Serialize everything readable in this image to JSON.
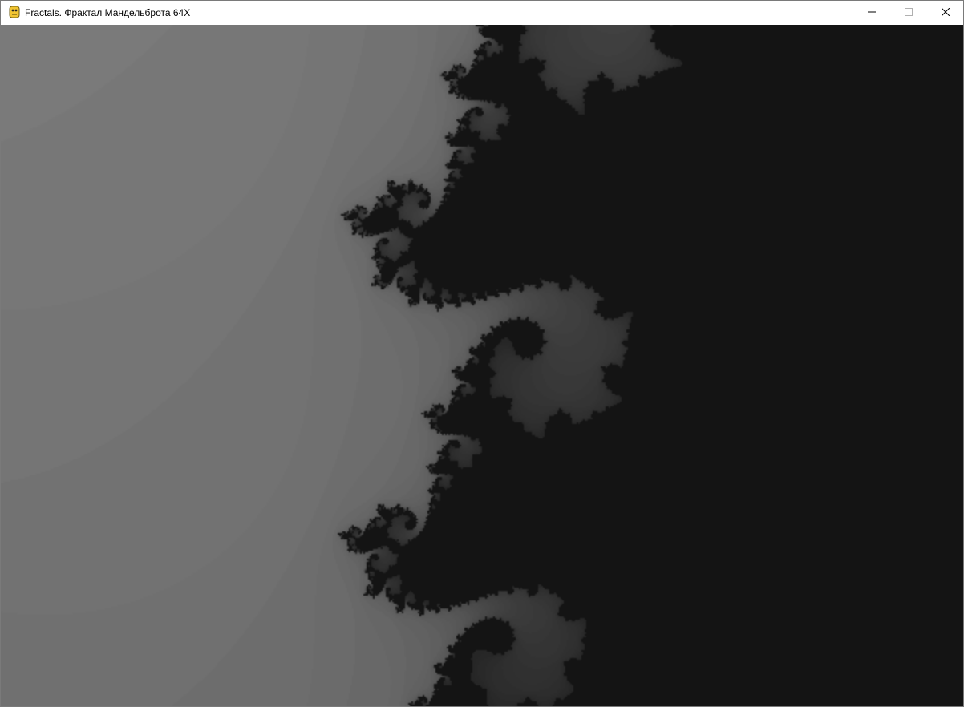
{
  "window": {
    "title": "Fractals. Фрактал Мандельброта 64X",
    "icon": "python-snake-icon",
    "controls": {
      "minimize_icon": "minimize-icon",
      "maximize_icon": "maximize-icon",
      "close_icon": "close-icon"
    }
  },
  "fractal": {
    "type": "mandelbrot",
    "max_iterations": 64,
    "colors": {
      "inside": "#141414",
      "outer_light": "#ececec",
      "mid": "#c0c0c0",
      "edge_dark": "#3a3a3a"
    }
  }
}
